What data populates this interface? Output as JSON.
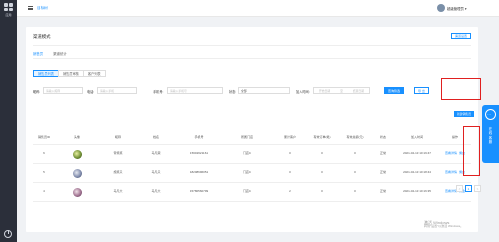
{
  "sidebar": {
    "app_label": "应用"
  },
  "topbar": {
    "breadcrumb": "目标树",
    "user": "超级管理员 ▾"
  },
  "page": {
    "title": "渠道模式",
    "action_label": "渠道设置"
  },
  "main_tabs": [
    "销售员",
    "渠道统计"
  ],
  "sub_tabs": [
    "销售员列表",
    "销售员审核",
    "客户列表"
  ],
  "filter": {
    "name_label": "昵称:",
    "name_placeholder": "请输入昵称",
    "phone_label": "电话:",
    "phone_placeholder": "请输入手机",
    "shop_label": "手机号:",
    "shop_placeholder": "请输入手机号",
    "status_label": "状态:",
    "status_value": "全部",
    "time_label": "加入时间:",
    "time_start": "开始日期",
    "time_sep": "至",
    "time_end": "结束日期",
    "search_label": "查询筛选",
    "reset_label": "导 出"
  },
  "export_label": "新建销售员",
  "table": {
    "headers": [
      "销售员ID",
      "头像",
      "昵称",
      "姓名",
      "手机号",
      "所属门店",
      "累计客户",
      "有效订单(笔)",
      "有效总额(元)",
      "状态",
      "加入时间",
      "操作"
    ],
    "rows": [
      {
        "id": "6",
        "nickname": "帝笑笑",
        "name": "马凡荣",
        "phone": "15602621161",
        "store": "门店C",
        "customers": "0",
        "orders": "0",
        "amount": "0",
        "status": "正常",
        "joined": "2021-04-13 10:19:47",
        "op1": "查看详情",
        "op2": "佣金"
      },
      {
        "id": "5",
        "nickname": "施笑只",
        "name": "马凡只",
        "phone": "18208696051",
        "store": "门店C",
        "customers": "0",
        "orders": "0",
        "amount": "0",
        "status": "正常",
        "joined": "2021-04-13 10:18:44",
        "op1": "查看详情",
        "op2": "佣金"
      },
      {
        "id": "4",
        "nickname": "马凡大",
        "name": "马凡大",
        "phone": "15780560799",
        "store": "门店C",
        "customers": "2",
        "orders": "0",
        "amount": "0",
        "status": "正常",
        "joined": "2021-04-13 10:16:35",
        "op1": "查看详情",
        "op2": "佣金"
      }
    ]
  },
  "pager": {
    "prev": "<",
    "current": "1",
    "next": ">"
  },
  "float_panel": {
    "label": "在线客服"
  },
  "watermark": {
    "line1": "激活 Windows",
    "line2": "转到\"设置\"以激活 Windows。"
  }
}
